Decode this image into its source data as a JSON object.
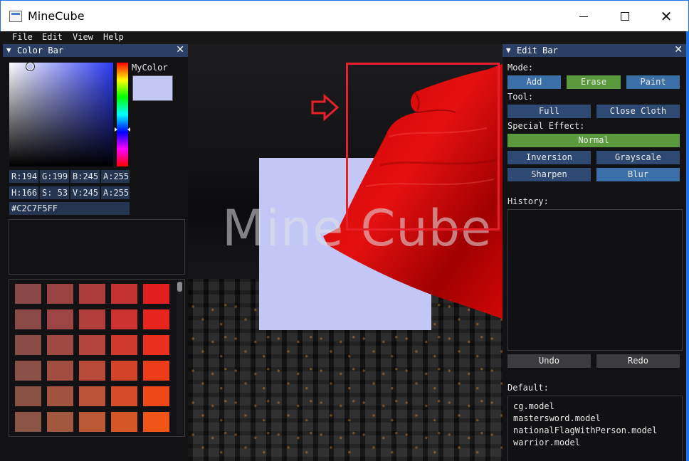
{
  "window": {
    "title": "MineCube"
  },
  "menu": [
    "File",
    "Edit",
    "View",
    "Help"
  ],
  "color_bar": {
    "title": "Color Bar",
    "mycolor_label": "MyColor",
    "mycolor_hex_value": "#C2C7F5",
    "rgba": {
      "r": "R:194",
      "g": "G:199",
      "b": "B:245",
      "a": "A:255"
    },
    "hsva": {
      "h": "H:166",
      "s": "S: 53",
      "v": "V:245",
      "a": "A:255"
    },
    "hex": "#C2C7F5FF",
    "palette_colors": [
      "#8a4848",
      "#9a4343",
      "#ad3c3c",
      "#c43232",
      "#e21e1e",
      "#8a4a48",
      "#9c4544",
      "#b23e3b",
      "#cc3330",
      "#e8241e",
      "#8a4c47",
      "#9e4a43",
      "#b5443a",
      "#cf3a2d",
      "#ea301c",
      "#8a4f46",
      "#a04e42",
      "#b74a38",
      "#d2432a",
      "#ec3c1a",
      "#8a5245",
      "#a15340",
      "#b95237",
      "#d44c28",
      "#ee4818",
      "#8a5544",
      "#a2573f",
      "#bb5935",
      "#d65626",
      "#f05416",
      "#8a5844",
      "#a35b3e",
      "#bd5f34",
      "#d85e24",
      "#f25f14"
    ]
  },
  "viewport": {
    "watermark": "Mine Cube",
    "quad_color": "#C2C7F5"
  },
  "edit_bar": {
    "title": "Edit Bar",
    "mode_label": "Mode:",
    "mode_buttons": {
      "add": "Add",
      "erase": "Erase",
      "paint": "Paint"
    },
    "tool_label": "Tool:",
    "tool_buttons": {
      "full": "Full",
      "close_cloth": "Close Cloth"
    },
    "effect_label": "Special Effect:",
    "effect_buttons": {
      "normal": "Normal",
      "inversion": "Inversion",
      "grayscale": "Grayscale",
      "sharpen": "Sharpen",
      "blur": "Blur"
    },
    "history_label": "History:",
    "undo": "Undo",
    "redo": "Redo",
    "default_label": "Default:",
    "default_models": [
      "cg.model",
      "mastersword.model",
      "nationalFlagWithPerson.model",
      "warrior.model"
    ]
  }
}
